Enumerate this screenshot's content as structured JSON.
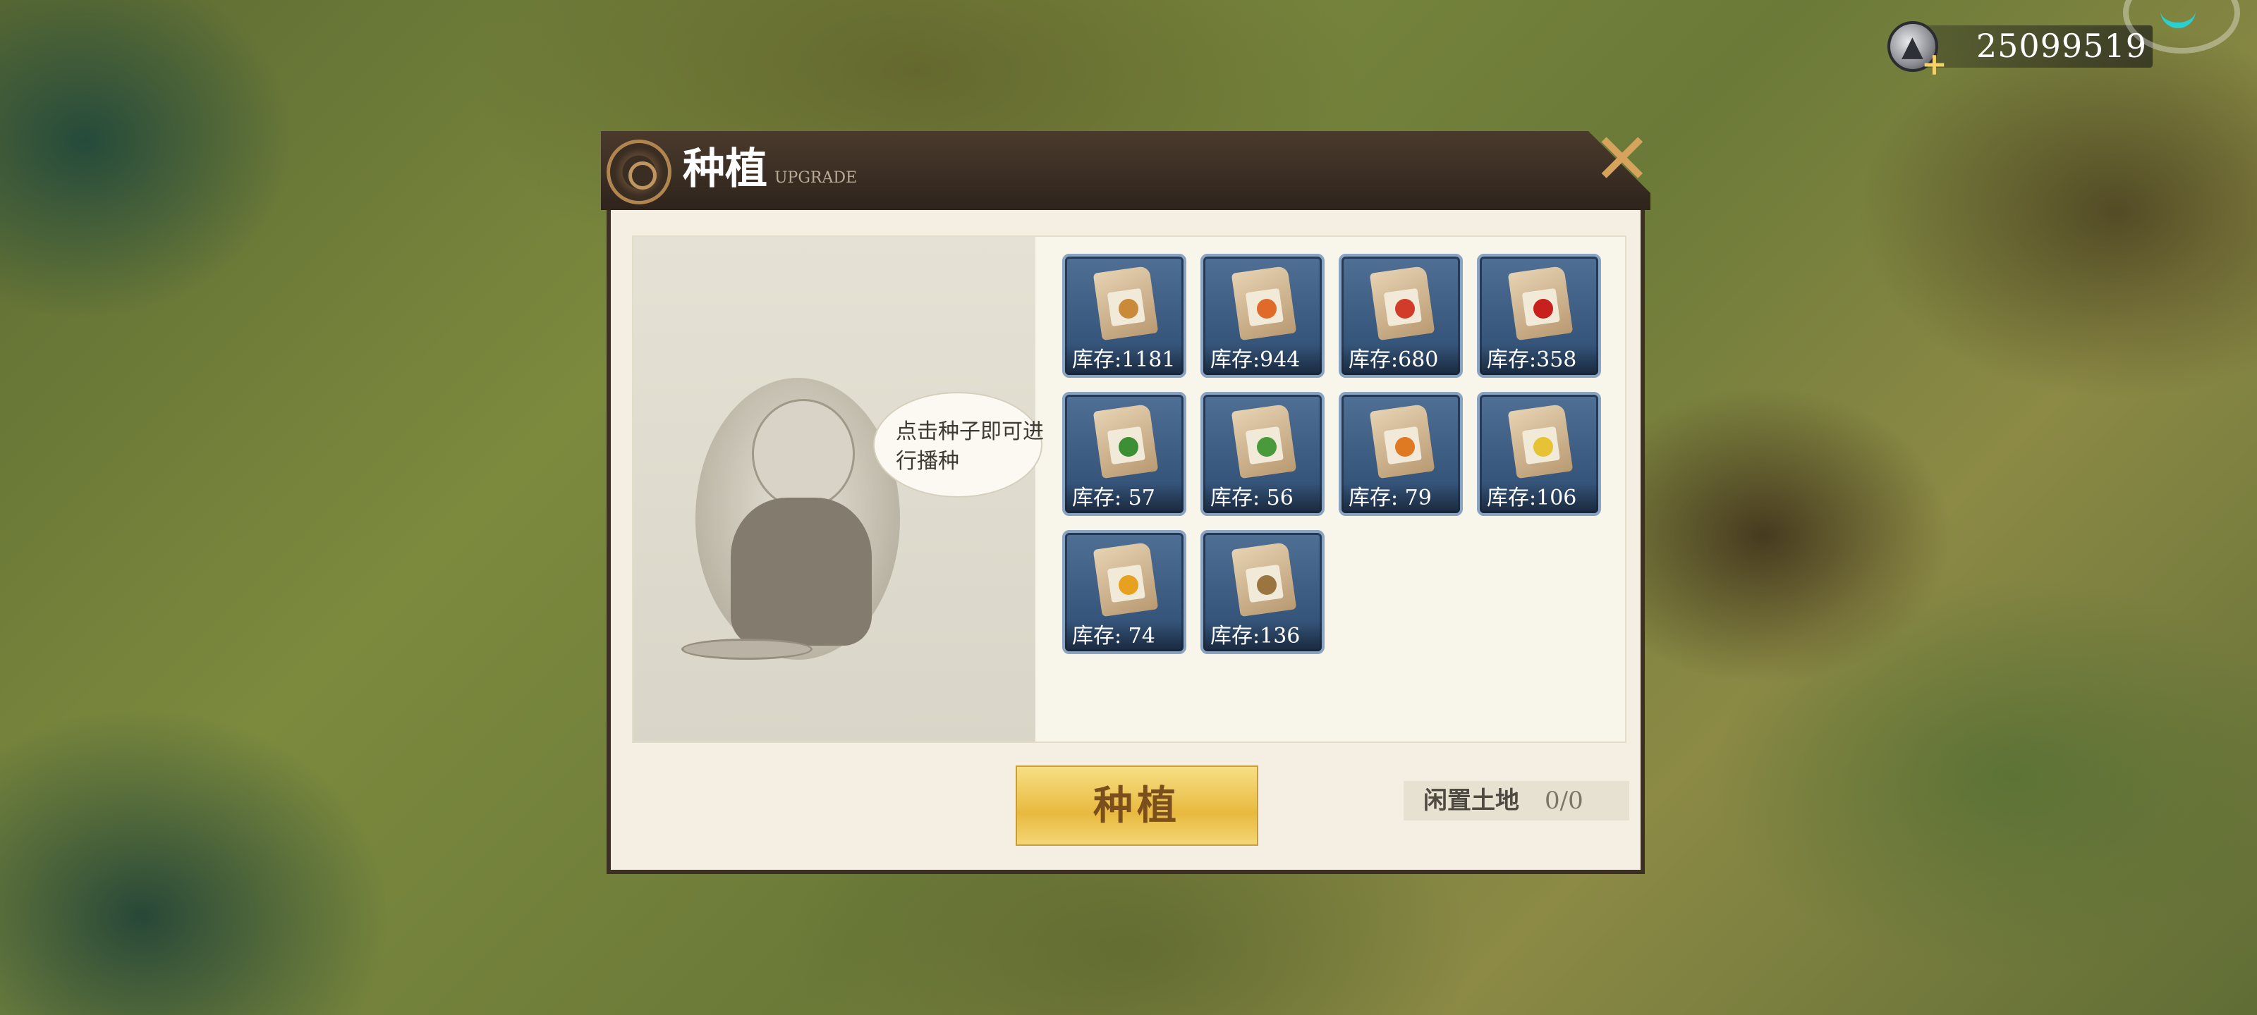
{
  "currency": {
    "icon": "silver-coin-icon",
    "value": "25099519"
  },
  "dialog": {
    "title": "种植",
    "subtitle": "UPGRADE",
    "close_icon": "close-icon",
    "hint": "点击种子即可进行播种",
    "seeds": [
      {
        "crop": "wheat",
        "stock": "库存:1181"
      },
      {
        "crop": "carrot",
        "stock": "库存:944"
      },
      {
        "crop": "tomato",
        "stock": "库存:680"
      },
      {
        "crop": "chili",
        "stock": "库存:358"
      },
      {
        "crop": "cabbage",
        "stock": "库存: 57"
      },
      {
        "crop": "lettuce",
        "stock": "库存: 56"
      },
      {
        "crop": "pumpkin",
        "stock": "库存: 79"
      },
      {
        "crop": "corn",
        "stock": "库存:106"
      },
      {
        "crop": "flower",
        "stock": "库存: 74"
      },
      {
        "crop": "potato",
        "stock": "库存:136"
      }
    ],
    "plant_button": "种植",
    "idle_land": {
      "label": "闲置土地",
      "value": "0/0"
    }
  },
  "colors": {
    "accent_gold": "#e8b93f",
    "header_brown": "#3a2d22",
    "slot_blue": "#3c5a80"
  }
}
